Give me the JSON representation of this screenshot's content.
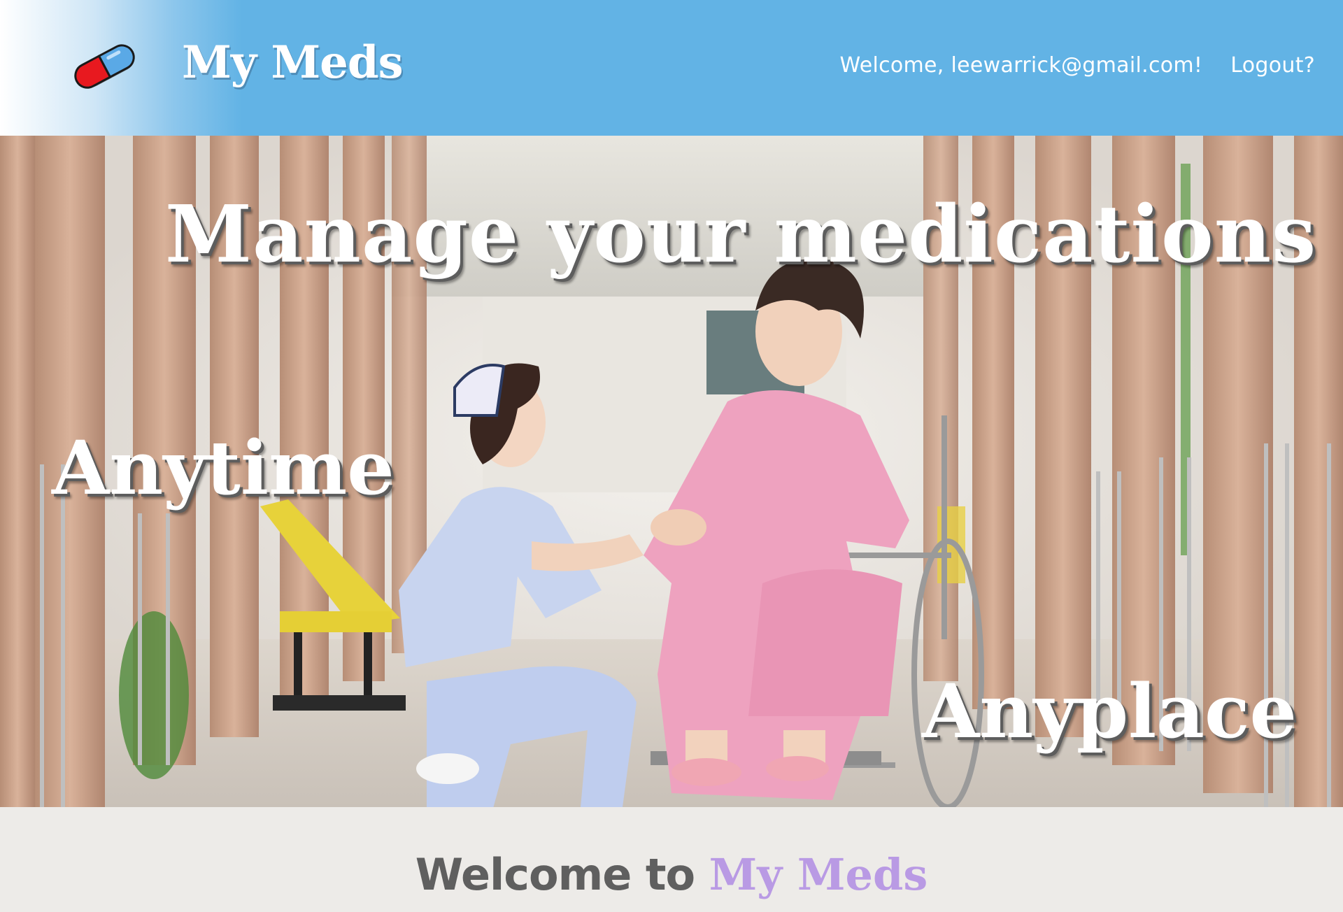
{
  "header": {
    "brand": "My Meds",
    "logo_icon": "pill-capsule-icon",
    "welcome_text": "Welcome, leewarrick@gmail.com!",
    "logout_label": "Logout?"
  },
  "hero": {
    "headline": "Manage your medications",
    "tagline_left": "Anytime",
    "tagline_right": "Anyplace",
    "image_description_icon": "nurse-and-patient-photo"
  },
  "welcome_section": {
    "prefix": "Welcome to",
    "brand": "My Meds"
  },
  "colors": {
    "header_blue": "#62b3e5",
    "brand_purple": "#b99ae4",
    "band_bg": "#edebe8",
    "pill_red": "#e8191f",
    "pill_blue": "#5aa9e6"
  }
}
